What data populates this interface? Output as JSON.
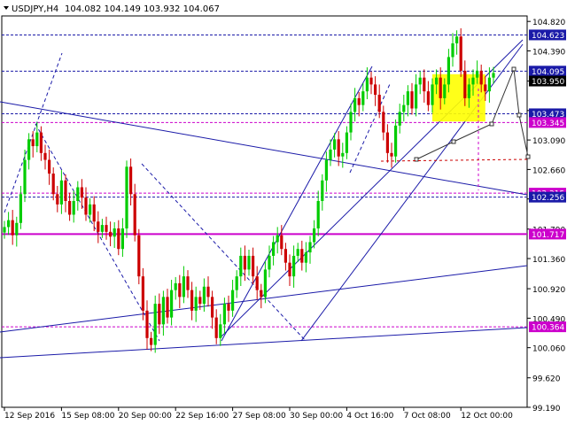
{
  "header": {
    "symbol_label": "USDJPY,H4",
    "ohlc": "104.082 104.149 103.932 104.067"
  },
  "colors": {
    "bull": "#00cc00",
    "bear": "#cc0000",
    "trendline": "#1a1aa8",
    "magenta": "#cc00cc",
    "box_fill": "#ffff00",
    "tag_blue": "#1a1aa8",
    "tag_magenta": "#cc00cc",
    "forecast": "#333333"
  },
  "chart_data": {
    "type": "candlestick",
    "title": "USDJPY,H4",
    "ylim": [
      99.19,
      104.9
    ],
    "y_ticks": [
      104.82,
      104.39,
      103.95,
      103.52,
      103.09,
      102.66,
      102.23,
      101.79,
      101.36,
      100.92,
      100.49,
      100.06,
      99.62,
      99.19
    ],
    "y_tick_labels": [
      "104.820",
      "104.390",
      "103.950",
      "103.520",
      "103.090",
      "102.660",
      "102.230",
      "101.790",
      "101.360",
      "100.920",
      "100.490",
      "100.060",
      "99.620",
      "99.190"
    ],
    "x_labels": [
      "12 Sep 2016",
      "15 Sep 08:00",
      "20 Sep 00:00",
      "22 Sep 16:00",
      "27 Sep 08:00",
      "30 Sep 00:00",
      "4 Oct 16:00",
      "7 Oct 08:00",
      "12 Oct 00:00"
    ],
    "x_label_bar_index": [
      0,
      14,
      28,
      42,
      56,
      70,
      84,
      98,
      112
    ],
    "bar_count": 127,
    "closes": [
      101.82,
      101.92,
      101.7,
      101.88,
      102.3,
      102.8,
      103.1,
      103.0,
      103.2,
      102.9,
      102.8,
      102.6,
      102.3,
      102.15,
      102.5,
      102.2,
      102.0,
      102.2,
      102.4,
      102.25,
      102.0,
      102.15,
      101.9,
      101.75,
      101.85,
      101.75,
      101.68,
      101.8,
      101.5,
      101.8,
      102.7,
      102.3,
      101.7,
      101.1,
      100.6,
      100.2,
      100.1,
      100.7,
      100.4,
      100.8,
      100.5,
      100.9,
      101.0,
      100.8,
      101.1,
      100.9,
      100.6,
      100.8,
      100.7,
      100.95,
      100.8,
      100.5,
      100.2,
      100.4,
      100.7,
      100.6,
      100.9,
      101.1,
      101.4,
      101.2,
      101.4,
      101.1,
      100.9,
      100.8,
      101.2,
      101.4,
      101.6,
      101.7,
      101.5,
      101.3,
      101.1,
      101.4,
      101.5,
      101.3,
      101.45,
      101.6,
      101.8,
      102.2,
      102.5,
      102.8,
      102.95,
      103.1,
      102.85,
      102.9,
      103.2,
      103.5,
      103.7,
      103.6,
      103.8,
      104.0,
      103.9,
      103.75,
      103.5,
      103.2,
      102.9,
      102.85,
      103.3,
      103.5,
      103.6,
      103.8,
      103.55,
      103.9,
      104.0,
      103.8,
      103.6,
      103.9,
      104.0,
      103.7,
      103.9,
      104.3,
      104.5,
      104.6,
      104.1,
      103.7,
      103.9,
      104.0,
      104.1,
      103.9,
      103.8,
      104.0,
      104.067
    ],
    "price_tags": [
      {
        "label": "104.623",
        "value": 104.623,
        "style": "blue"
      },
      {
        "label": "104.095",
        "value": 104.095,
        "style": "blue"
      },
      {
        "label": "103.473",
        "value": 103.473,
        "style": "blue"
      },
      {
        "label": "103.345",
        "value": 103.345,
        "style": "magenta"
      },
      {
        "label": "102.315",
        "value": 102.315,
        "style": "magenta"
      },
      {
        "label": "102.256",
        "value": 102.256,
        "style": "blue"
      },
      {
        "label": "101.717",
        "value": 101.717,
        "style": "magenta"
      },
      {
        "label": "100.364",
        "value": 100.364,
        "style": "magenta"
      }
    ],
    "tag_labels_visible": [
      "104.623",
      "104.095",
      "103.473",
      "103.345",
      "102.315",
      "102.256",
      "101.717",
      "100.364"
    ],
    "current_price_label": "103.950",
    "grid": false,
    "legend": "none"
  }
}
